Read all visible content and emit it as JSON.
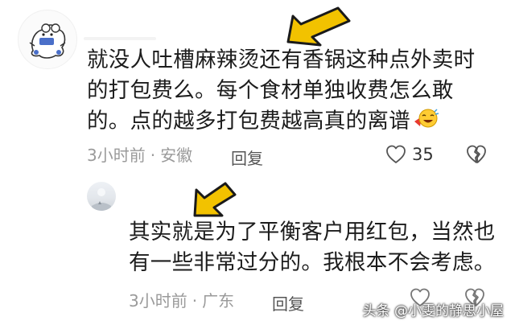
{
  "comments": [
    {
      "text_line1": "就没人吐槽麻辣烫还有香锅这种点外卖时",
      "text_line2": "的打包费么。每个食材单独收费怎么敢",
      "text_line3": "的。点的越多打包费越高真的离谱",
      "time": "3小时前",
      "dot": "·",
      "location": "安徽",
      "reply_label": "回复",
      "like_count": "35",
      "icons": [
        "avatar-sticker",
        "emoji-laughing",
        "heart-icon",
        "broken-heart-icon"
      ]
    },
    {
      "text_line1": "其实就是为了平衡客户用红包，当然也",
      "text_line2": "有一些非常过分的。我根本不会考虑。",
      "time": "3小时前",
      "dot": "·",
      "location": "广东",
      "reply_label": "回复",
      "icons": [
        "avatar-moon",
        "heart-icon",
        "broken-heart-icon"
      ]
    }
  ],
  "watermark": "头条 @小雯的静思小屋",
  "colors": {
    "text": "#1c1c1c",
    "meta": "#9a9a9a",
    "arrow_fill": "#f2c200",
    "arrow_stroke": "#1a1a1a"
  }
}
